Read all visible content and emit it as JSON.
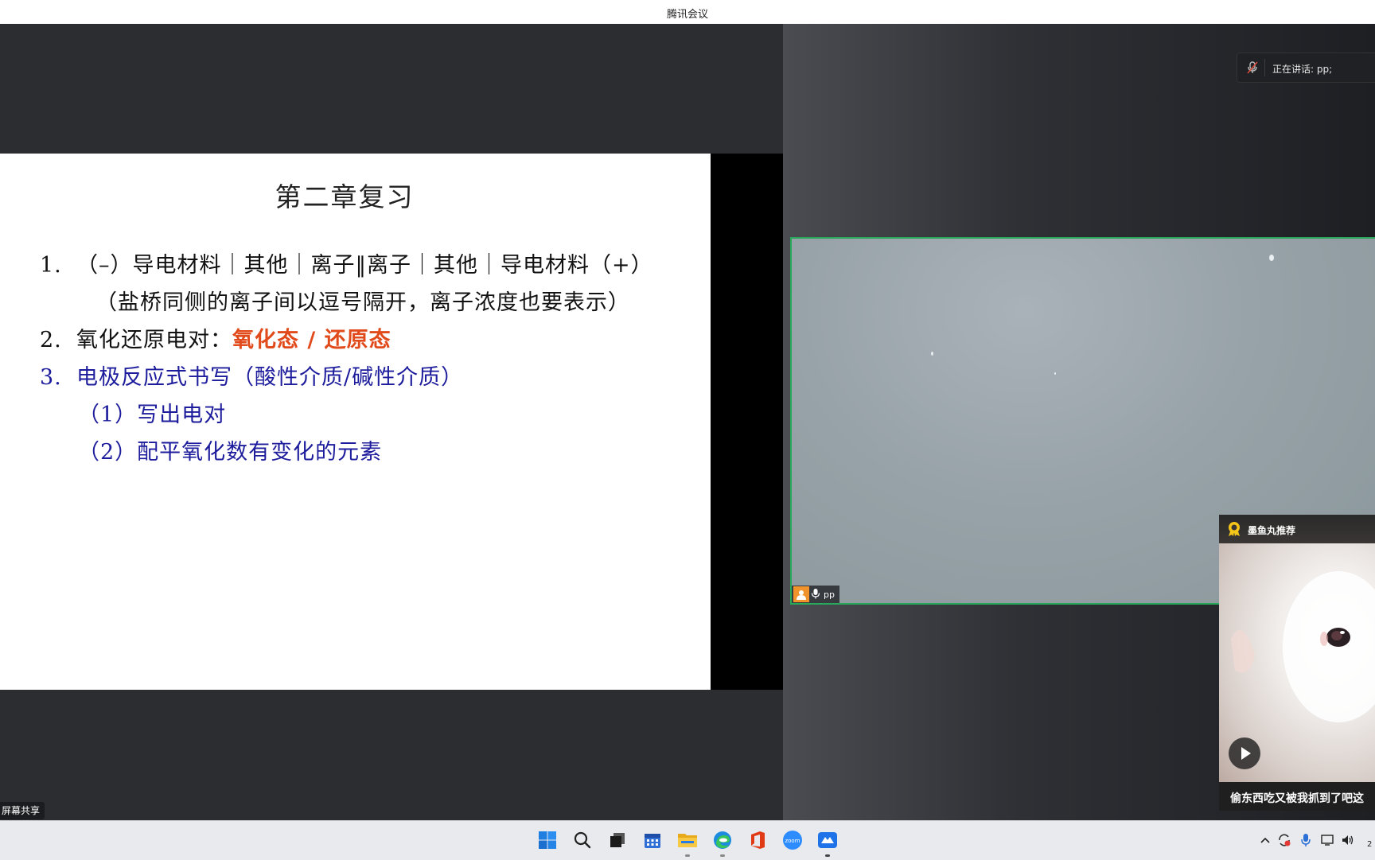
{
  "window": {
    "title": "腾讯会议"
  },
  "slide": {
    "title": "第二章复习",
    "lines": [
      {
        "num": "1.",
        "text": "（–）导电材料｜其他｜离子‖离子｜其他｜导电材料（+）"
      },
      {
        "text": "（盐桥同侧的离子间以逗号隔开，离子浓度也要表示）"
      },
      {
        "num": "2.",
        "text": "氧化还原电对：",
        "highlight": "氧化态 / 还原态"
      },
      {
        "num": "3.",
        "text": "电极反应式书写（酸性介质/碱性介质）"
      },
      {
        "text": "（1）写出电对"
      },
      {
        "text": "（2）配平氧化数有变化的元素"
      }
    ],
    "colors": {
      "highlight": "#e14b1c",
      "blue": "#1d1c9c"
    }
  },
  "speaking": {
    "text": "正在讲话: pp;",
    "icon": "mic-muted-icon"
  },
  "video": {
    "participant_name": "pp",
    "border_color": "#28a85a"
  },
  "promo": {
    "header": "墨鱼丸推荐",
    "caption": "偷东西吃又被我抓到了吧这",
    "icon": "play-icon"
  },
  "share_label": "屏幕共享",
  "taskbar": {
    "apps": [
      "windows-start-icon",
      "search-icon",
      "task-view-icon",
      "calendar-icon",
      "file-explorer-icon",
      "edge-icon",
      "office-icon",
      "zoom-icon",
      "tencent-meeting-icon"
    ],
    "zoom_label": "zoom",
    "clock_partial": "2"
  }
}
